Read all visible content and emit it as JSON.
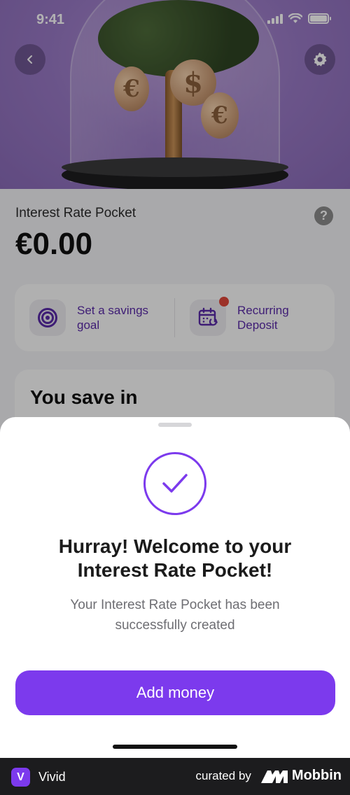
{
  "status_bar": {
    "time": "9:41"
  },
  "pocket": {
    "title": "Interest Rate Pocket",
    "balance": "€0.00",
    "help_glyph": "?"
  },
  "actions": [
    {
      "label": "Set a savings goal",
      "icon": "target-icon"
    },
    {
      "label": "Recurring Deposit",
      "icon": "calendar-recurring-icon",
      "notification_dot": true
    }
  ],
  "save_section": {
    "title": "You save in"
  },
  "sheet": {
    "title": "Hurray! Welcome to your Interest Rate Pocket!",
    "subtitle": "Your Interest Rate Pocket has been successfully created",
    "primary_button": "Add money"
  },
  "footer": {
    "brand_logo": "V",
    "brand_name": "Vivid",
    "curated_by": "curated by",
    "curator": "Mobbin"
  },
  "colors": {
    "accent": "#7c3aed",
    "accent_text": "#5a2aa8",
    "notification": "#e0473a"
  }
}
